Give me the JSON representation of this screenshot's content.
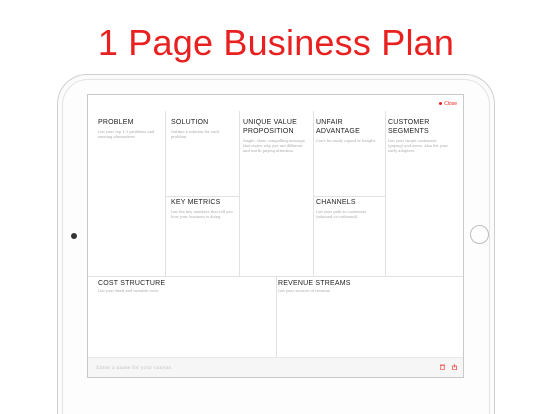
{
  "headline": "1 Page Business Plan",
  "screen": {
    "close_label": "Close",
    "cells": {
      "problem": {
        "title": "PROBLEM",
        "desc": "List your top 1-3 problems and existing alternatives"
      },
      "solution": {
        "title": "SOLUTION",
        "desc": "Outline a solution for each problem."
      },
      "uvp": {
        "title": "UNIQUE VALUE PROPOSITION",
        "desc": "Single, clear, compelling message that states why you are different and worth paying attention."
      },
      "unfair": {
        "title": "UNFAIR ADVANTAGE",
        "desc": "Can't be easily copied or bought."
      },
      "segments": {
        "title": "CUSTOMER SEGMENTS",
        "desc": "List your target customers (paying) and users. Also list your early adopters."
      },
      "metrics": {
        "title": "KEY METRICS",
        "desc": "List the key numbers that tell you how your business is doing."
      },
      "channels": {
        "title": "CHANNELS",
        "desc": "List your path to customers (inbound or outbound)."
      },
      "cost": {
        "title": "COST STRUCTURE",
        "desc": "List your fixed and variable costs"
      },
      "revenue": {
        "title": "REVENUE STREAMS",
        "desc": "List your sources of revenue."
      }
    },
    "bottom_bar": {
      "placeholder": "Enter a name for your canvas"
    }
  },
  "icons": {
    "trash": "trash-icon",
    "share": "share-icon"
  },
  "colors": {
    "accent": "#e8201f"
  }
}
